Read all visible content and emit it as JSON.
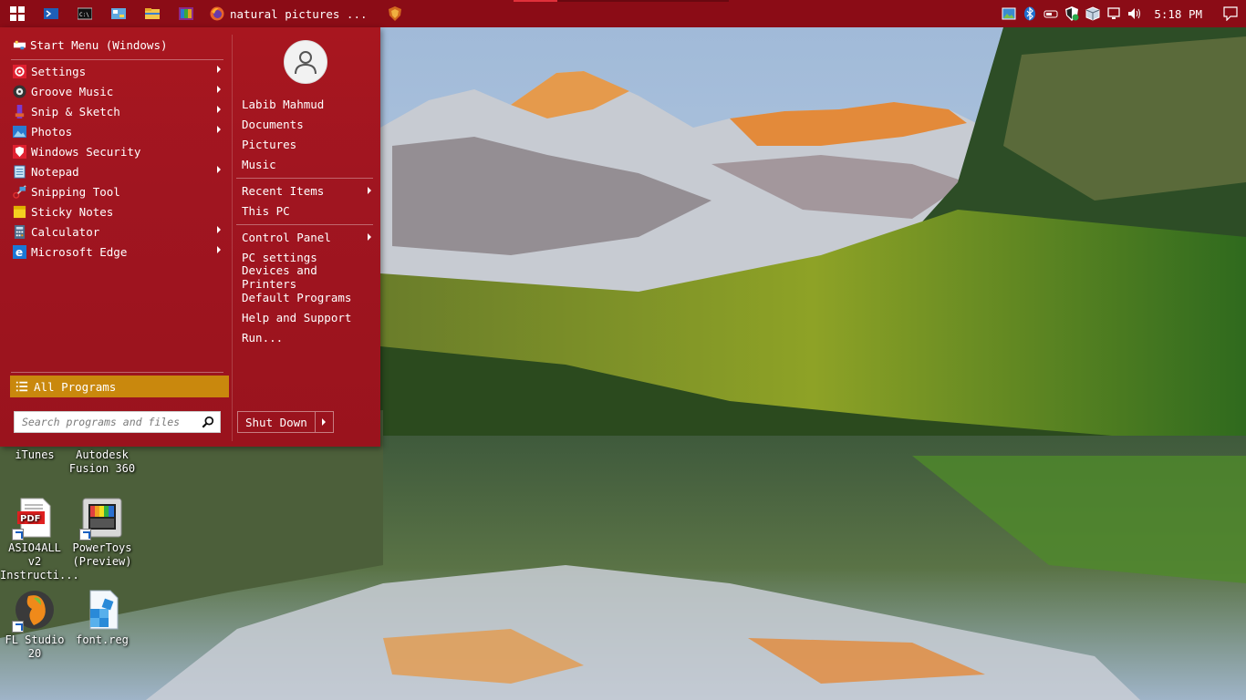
{
  "taskbar": {
    "pinned": [
      {
        "name": "windows-start-icon"
      },
      {
        "name": "powershell-icon"
      },
      {
        "name": "cmd-icon"
      },
      {
        "name": "control-panel-icon"
      },
      {
        "name": "file-explorer-icon"
      },
      {
        "name": "winrar-icon"
      }
    ],
    "active_window": {
      "icon": "firefox-icon",
      "title": "natural pictures ..."
    },
    "extra_icon": "shield-brave-icon",
    "tray_icons": [
      "photo-app-icon",
      "bluetooth-icon",
      "bluetooth-device-icon",
      "security-shield-icon",
      "package-icon",
      "network-icon",
      "volume-icon"
    ],
    "clock": "5:18 PM",
    "notification_icon": "notification-icon"
  },
  "start_menu": {
    "header": "Start Menu (Windows)",
    "items": [
      {
        "label": "Settings",
        "icon": "gear-icon",
        "arrow": true
      },
      {
        "label": "Groove Music",
        "icon": "groove-icon",
        "arrow": true
      },
      {
        "label": "Snip & Sketch",
        "icon": "snip-icon",
        "arrow": true
      },
      {
        "label": "Photos",
        "icon": "photos-icon",
        "arrow": true
      },
      {
        "label": "Windows Security",
        "icon": "shield-icon",
        "arrow": false
      },
      {
        "label": "Notepad",
        "icon": "notepad-icon",
        "arrow": true
      },
      {
        "label": "Snipping Tool",
        "icon": "scissors-icon",
        "arrow": false
      },
      {
        "label": "Sticky Notes",
        "icon": "sticky-notes-icon",
        "arrow": false
      },
      {
        "label": "Calculator",
        "icon": "calculator-icon",
        "arrow": true
      },
      {
        "label": "Microsoft Edge",
        "icon": "edge-icon",
        "arrow": true
      }
    ],
    "all_programs": "All Programs",
    "search_placeholder": "Search programs and files",
    "user": {
      "name": "Labib Mahmud",
      "links1": [
        "Documents",
        "Pictures",
        "Music"
      ],
      "links2": [
        {
          "label": "Recent Items",
          "arrow": true
        },
        {
          "label": "This PC",
          "arrow": false
        }
      ],
      "links3": [
        {
          "label": "Control Panel",
          "arrow": true
        },
        {
          "label": "PC settings",
          "arrow": false
        },
        {
          "label": "Devices and Printers",
          "arrow": false
        },
        {
          "label": "Default Programs",
          "arrow": false
        },
        {
          "label": "Help and Support",
          "arrow": false
        },
        {
          "label": "Run...",
          "arrow": false
        }
      ]
    },
    "shutdown": "Shut Down"
  },
  "desktop_icons": [
    {
      "label1": "iTunes",
      "label2": "",
      "icon": "itunes-icon"
    },
    {
      "label1": "Autodesk",
      "label2": "Fusion 360",
      "icon": "fusion-icon"
    },
    {
      "label1": "ASIO4ALL v2",
      "label2": "Instructi...",
      "icon": "pdf-icon",
      "badge": "PDF"
    },
    {
      "label1": "PowerToys",
      "label2": "(Preview)",
      "icon": "powertoys-icon"
    },
    {
      "label1": "FL Studio",
      "label2": "20",
      "icon": "fl-studio-icon"
    },
    {
      "label1": "font.reg",
      "label2": "",
      "icon": "registry-icon"
    }
  ]
}
